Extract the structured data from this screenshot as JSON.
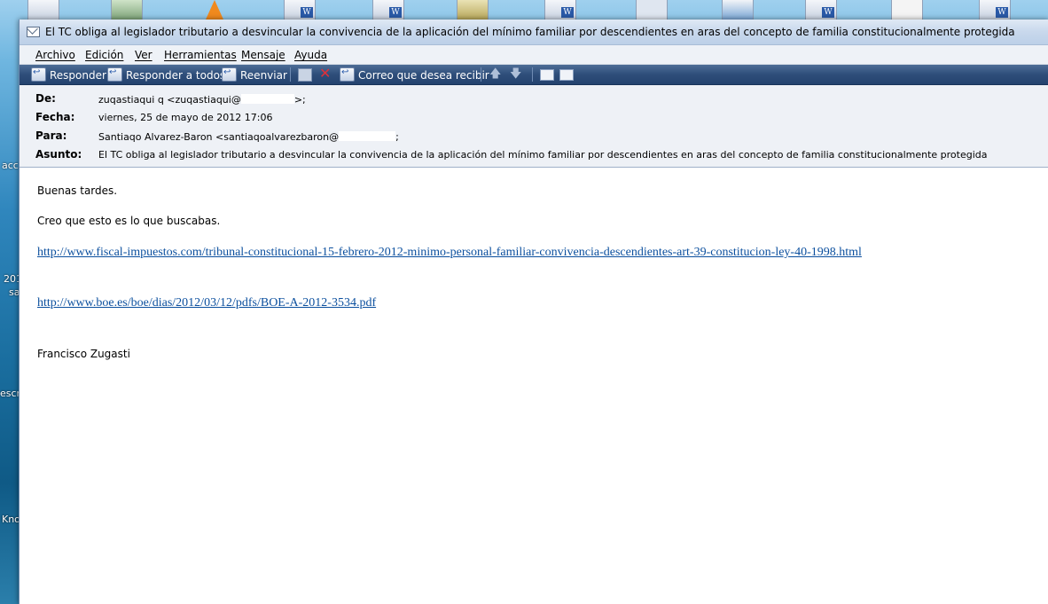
{
  "window": {
    "title": "El TC obliga al legislador tributario a desvincular la convivencia de la aplicación del mínimo familiar por descendientes en aras del concepto de familia constitucionalmente protegida"
  },
  "menu": {
    "items": [
      "Archivo",
      "Edición",
      "Ver",
      "Herramientas",
      "Mensaje",
      "Ayuda"
    ]
  },
  "toolbar": {
    "reply": "Responder",
    "reply_all": "Responder a todos",
    "forward": "Reenviar",
    "junk": "Correo que desea recibir"
  },
  "header": {
    "from_label": "De:",
    "from_value": "zuqastiaqui q <zuqastiaqui@",
    "from_tail": ">;",
    "date_label": "Fecha:",
    "date_value": "viernes, 25 de mayo de 2012 17:06",
    "to_label": "Para:",
    "to_value": "Santiaqo Alvarez-Baron <santiaqoalvarezbaron@",
    "to_tail": ";",
    "subject_label": "Asunto:",
    "subject_value": "El TC obliga al legislador tributario a desvincular la convivencia de la aplicación del mínimo familiar por descendientes en aras del concepto de familia constitucionalmente protegida"
  },
  "message": {
    "greeting": "Buenas tardes.",
    "line1": "Creo que esto es lo que buscabas.",
    "link1": "http://www.fiscal-impuestos.com/tribunal-constitucional-15-febrero-2012-minimo-personal-familiar-convivencia-descendientes-art-39-constitucion-ley-40-1998.html",
    "link2": "http://www.boe.es/boe/dias/2012/03/12/pdfs/BOE-A-2012-3534.pdf",
    "signature": "Francisco Zugasti"
  },
  "desktop": {
    "label1": "acc",
    "label2": "201",
    "label3": "sa",
    "label4": "escr",
    "label5": "Kno"
  }
}
